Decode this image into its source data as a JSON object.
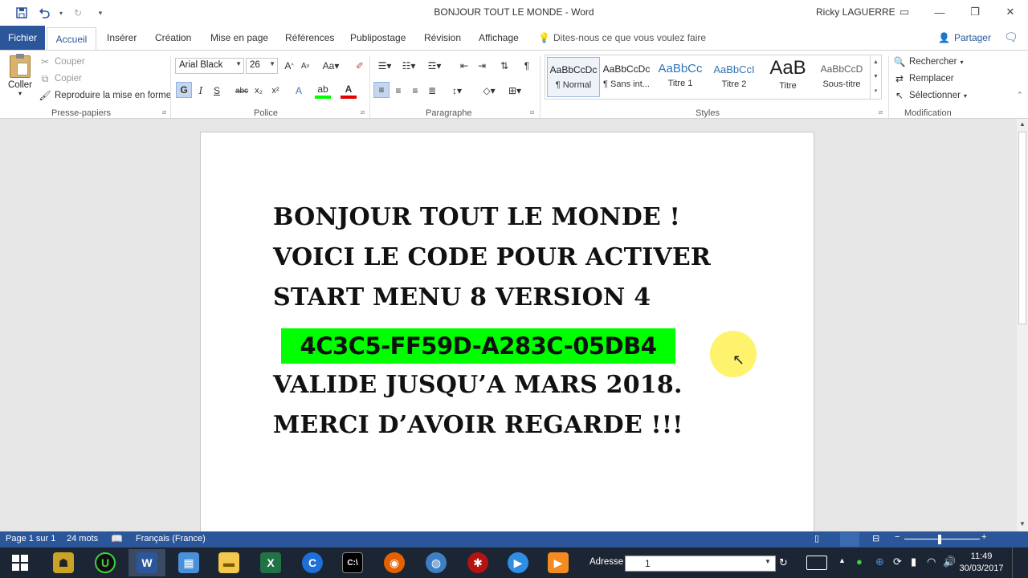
{
  "window": {
    "title": "BONJOUR TOUT LE MONDE  -  Word",
    "user": "Ricky LAGUERRE"
  },
  "tabs": {
    "file": "Fichier",
    "active": "Accueil",
    "items": [
      "Insérer",
      "Création",
      "Mise en page",
      "Références",
      "Publipostage",
      "Révision",
      "Affichage"
    ],
    "tell_me": "Dites-nous ce que vous voulez faire",
    "share": "Partager"
  },
  "clipboard": {
    "paste": "Coller",
    "cut": "Couper",
    "copy": "Copier",
    "format_painter": "Reproduire la mise en forme",
    "label": "Presse-papiers"
  },
  "font": {
    "name": "Arial Black",
    "size": "26",
    "label": "Police"
  },
  "paragraph": {
    "label": "Paragraphe"
  },
  "styles": {
    "label": "Styles",
    "items": [
      {
        "sample": "AaBbCcDc",
        "name": "¶ Normal"
      },
      {
        "sample": "AaBbCcDc",
        "name": "¶ Sans int..."
      },
      {
        "sample": "AaBbCc",
        "name": "Titre 1"
      },
      {
        "sample": "AaBbCcI",
        "name": "Titre 2"
      },
      {
        "sample": "AaB",
        "name": "Titre"
      },
      {
        "sample": "AaBbCcD",
        "name": "Sous-titre"
      }
    ]
  },
  "editing": {
    "find": "Rechercher",
    "replace": "Remplacer",
    "select": "Sélectionner",
    "label": "Modification"
  },
  "document": {
    "line1": "BONJOUR TOUT LE MONDE !",
    "line2": "VOICI LE CODE POUR ACTIVER",
    "line3": "START MENU 8 VERSION 4",
    "code": "4C3C5-FF59D-A283C-05DB4",
    "line5": "VALIDE JUSQU’A MARS 2018.",
    "line6": "MERCI D’AVOIR REGARDE !!!"
  },
  "status": {
    "page": "Page 1 sur 1",
    "words": "24 mots",
    "language": "Français (France)"
  },
  "taskbar": {
    "address_label": "Adresse",
    "address_value": "1",
    "time": "11:49",
    "date": "30/03/2017"
  },
  "colors": {
    "word_blue": "#2b579a",
    "highlight": "#00ff00"
  }
}
